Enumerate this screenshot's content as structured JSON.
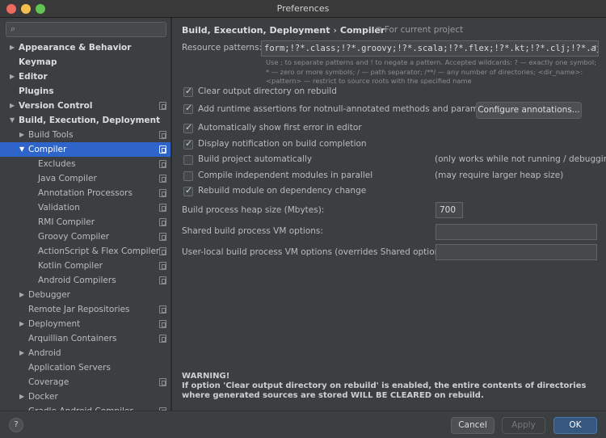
{
  "window": {
    "title": "Preferences"
  },
  "search": {
    "placeholder": ""
  },
  "tree": [
    {
      "label": "Appearance & Behavior",
      "level": 0,
      "arrow": "▶",
      "bold": true,
      "proj": false,
      "sel": false
    },
    {
      "label": "Keymap",
      "level": 0,
      "arrow": "",
      "bold": true,
      "proj": false,
      "sel": false
    },
    {
      "label": "Editor",
      "level": 0,
      "arrow": "▶",
      "bold": true,
      "proj": false,
      "sel": false
    },
    {
      "label": "Plugins",
      "level": 0,
      "arrow": "",
      "bold": true,
      "proj": false,
      "sel": false
    },
    {
      "label": "Version Control",
      "level": 0,
      "arrow": "▶",
      "bold": true,
      "proj": true,
      "sel": false
    },
    {
      "label": "Build, Execution, Deployment",
      "level": 0,
      "arrow": "▼",
      "bold": true,
      "proj": false,
      "sel": false
    },
    {
      "label": "Build Tools",
      "level": 1,
      "arrow": "▶",
      "bold": false,
      "proj": true,
      "sel": false
    },
    {
      "label": "Compiler",
      "level": 1,
      "arrow": "▼",
      "bold": false,
      "proj": true,
      "sel": true
    },
    {
      "label": "Excludes",
      "level": 2,
      "arrow": "",
      "bold": false,
      "proj": true,
      "sel": false
    },
    {
      "label": "Java Compiler",
      "level": 2,
      "arrow": "",
      "bold": false,
      "proj": true,
      "sel": false
    },
    {
      "label": "Annotation Processors",
      "level": 2,
      "arrow": "",
      "bold": false,
      "proj": true,
      "sel": false
    },
    {
      "label": "Validation",
      "level": 2,
      "arrow": "",
      "bold": false,
      "proj": true,
      "sel": false
    },
    {
      "label": "RMI Compiler",
      "level": 2,
      "arrow": "",
      "bold": false,
      "proj": true,
      "sel": false
    },
    {
      "label": "Groovy Compiler",
      "level": 2,
      "arrow": "",
      "bold": false,
      "proj": true,
      "sel": false
    },
    {
      "label": "ActionScript & Flex Compiler",
      "level": 2,
      "arrow": "",
      "bold": false,
      "proj": true,
      "sel": false
    },
    {
      "label": "Kotlin Compiler",
      "level": 2,
      "arrow": "",
      "bold": false,
      "proj": true,
      "sel": false
    },
    {
      "label": "Android Compilers",
      "level": 2,
      "arrow": "",
      "bold": false,
      "proj": true,
      "sel": false
    },
    {
      "label": "Debugger",
      "level": 1,
      "arrow": "▶",
      "bold": false,
      "proj": false,
      "sel": false
    },
    {
      "label": "Remote Jar Repositories",
      "level": 1,
      "arrow": "",
      "bold": false,
      "proj": true,
      "sel": false
    },
    {
      "label": "Deployment",
      "level": 1,
      "arrow": "▶",
      "bold": false,
      "proj": true,
      "sel": false
    },
    {
      "label": "Arquillian Containers",
      "level": 1,
      "arrow": "",
      "bold": false,
      "proj": true,
      "sel": false
    },
    {
      "label": "Android",
      "level": 1,
      "arrow": "▶",
      "bold": false,
      "proj": false,
      "sel": false
    },
    {
      "label": "Application Servers",
      "level": 1,
      "arrow": "",
      "bold": false,
      "proj": false,
      "sel": false
    },
    {
      "label": "Coverage",
      "level": 1,
      "arrow": "",
      "bold": false,
      "proj": true,
      "sel": false
    },
    {
      "label": "Docker",
      "level": 1,
      "arrow": "▶",
      "bold": false,
      "proj": false,
      "sel": false
    },
    {
      "label": "Gradle-Android Compiler",
      "level": 1,
      "arrow": "",
      "bold": false,
      "proj": true,
      "sel": false
    }
  ],
  "breadcrumb": {
    "parent": "Build, Execution, Deployment",
    "sep": "›",
    "current": "Compiler",
    "scope": "⧉ For current project"
  },
  "resource": {
    "label": "Resource patterns:",
    "value": "form;!?*.class;!?*.groovy;!?*.scala;!?*.flex;!?*.kt;!?*.clj;!?*.aj",
    "hint": "Use ; to separate patterns and ! to negate a pattern. Accepted wildcards: ? — exactly one symbol; * — zero or more symbols; / — path separator; /**/ — any number of directories; <dir_name>: <pattern> — restrict to source roots with the specified name"
  },
  "options": {
    "clear_output": {
      "label": "Clear output directory on rebuild",
      "checked": true
    },
    "runtime_assertions": {
      "label": "Add runtime assertions for notnull-annotated methods and parameters",
      "checked": true
    },
    "configure_button": "Configure annotations...",
    "show_first_error": {
      "label": "Automatically show first error in editor",
      "checked": true
    },
    "display_notification": {
      "label": "Display notification on build completion",
      "checked": true
    },
    "build_auto": {
      "label": "Build project automatically",
      "checked": false,
      "note": "(only works while not running / debugging)"
    },
    "parallel": {
      "label": "Compile independent modules in parallel",
      "checked": false,
      "note": "(may require larger heap size)"
    },
    "rebuild_dep": {
      "label": "Rebuild module on dependency change",
      "checked": true
    }
  },
  "heap": {
    "label": "Build process heap size (Mbytes):",
    "value": "700"
  },
  "shared_vm": {
    "label": "Shared build process VM options:",
    "value": ""
  },
  "user_vm": {
    "label": "User-local build process VM options (overrides Shared options):",
    "value": ""
  },
  "warning": {
    "title": "WARNING!",
    "text": "If option 'Clear output directory on rebuild' is enabled, the entire contents of directories where generated sources are stored WILL BE CLEARED on rebuild."
  },
  "footer": {
    "help": "?",
    "cancel": "Cancel",
    "apply": "Apply",
    "ok": "OK"
  }
}
